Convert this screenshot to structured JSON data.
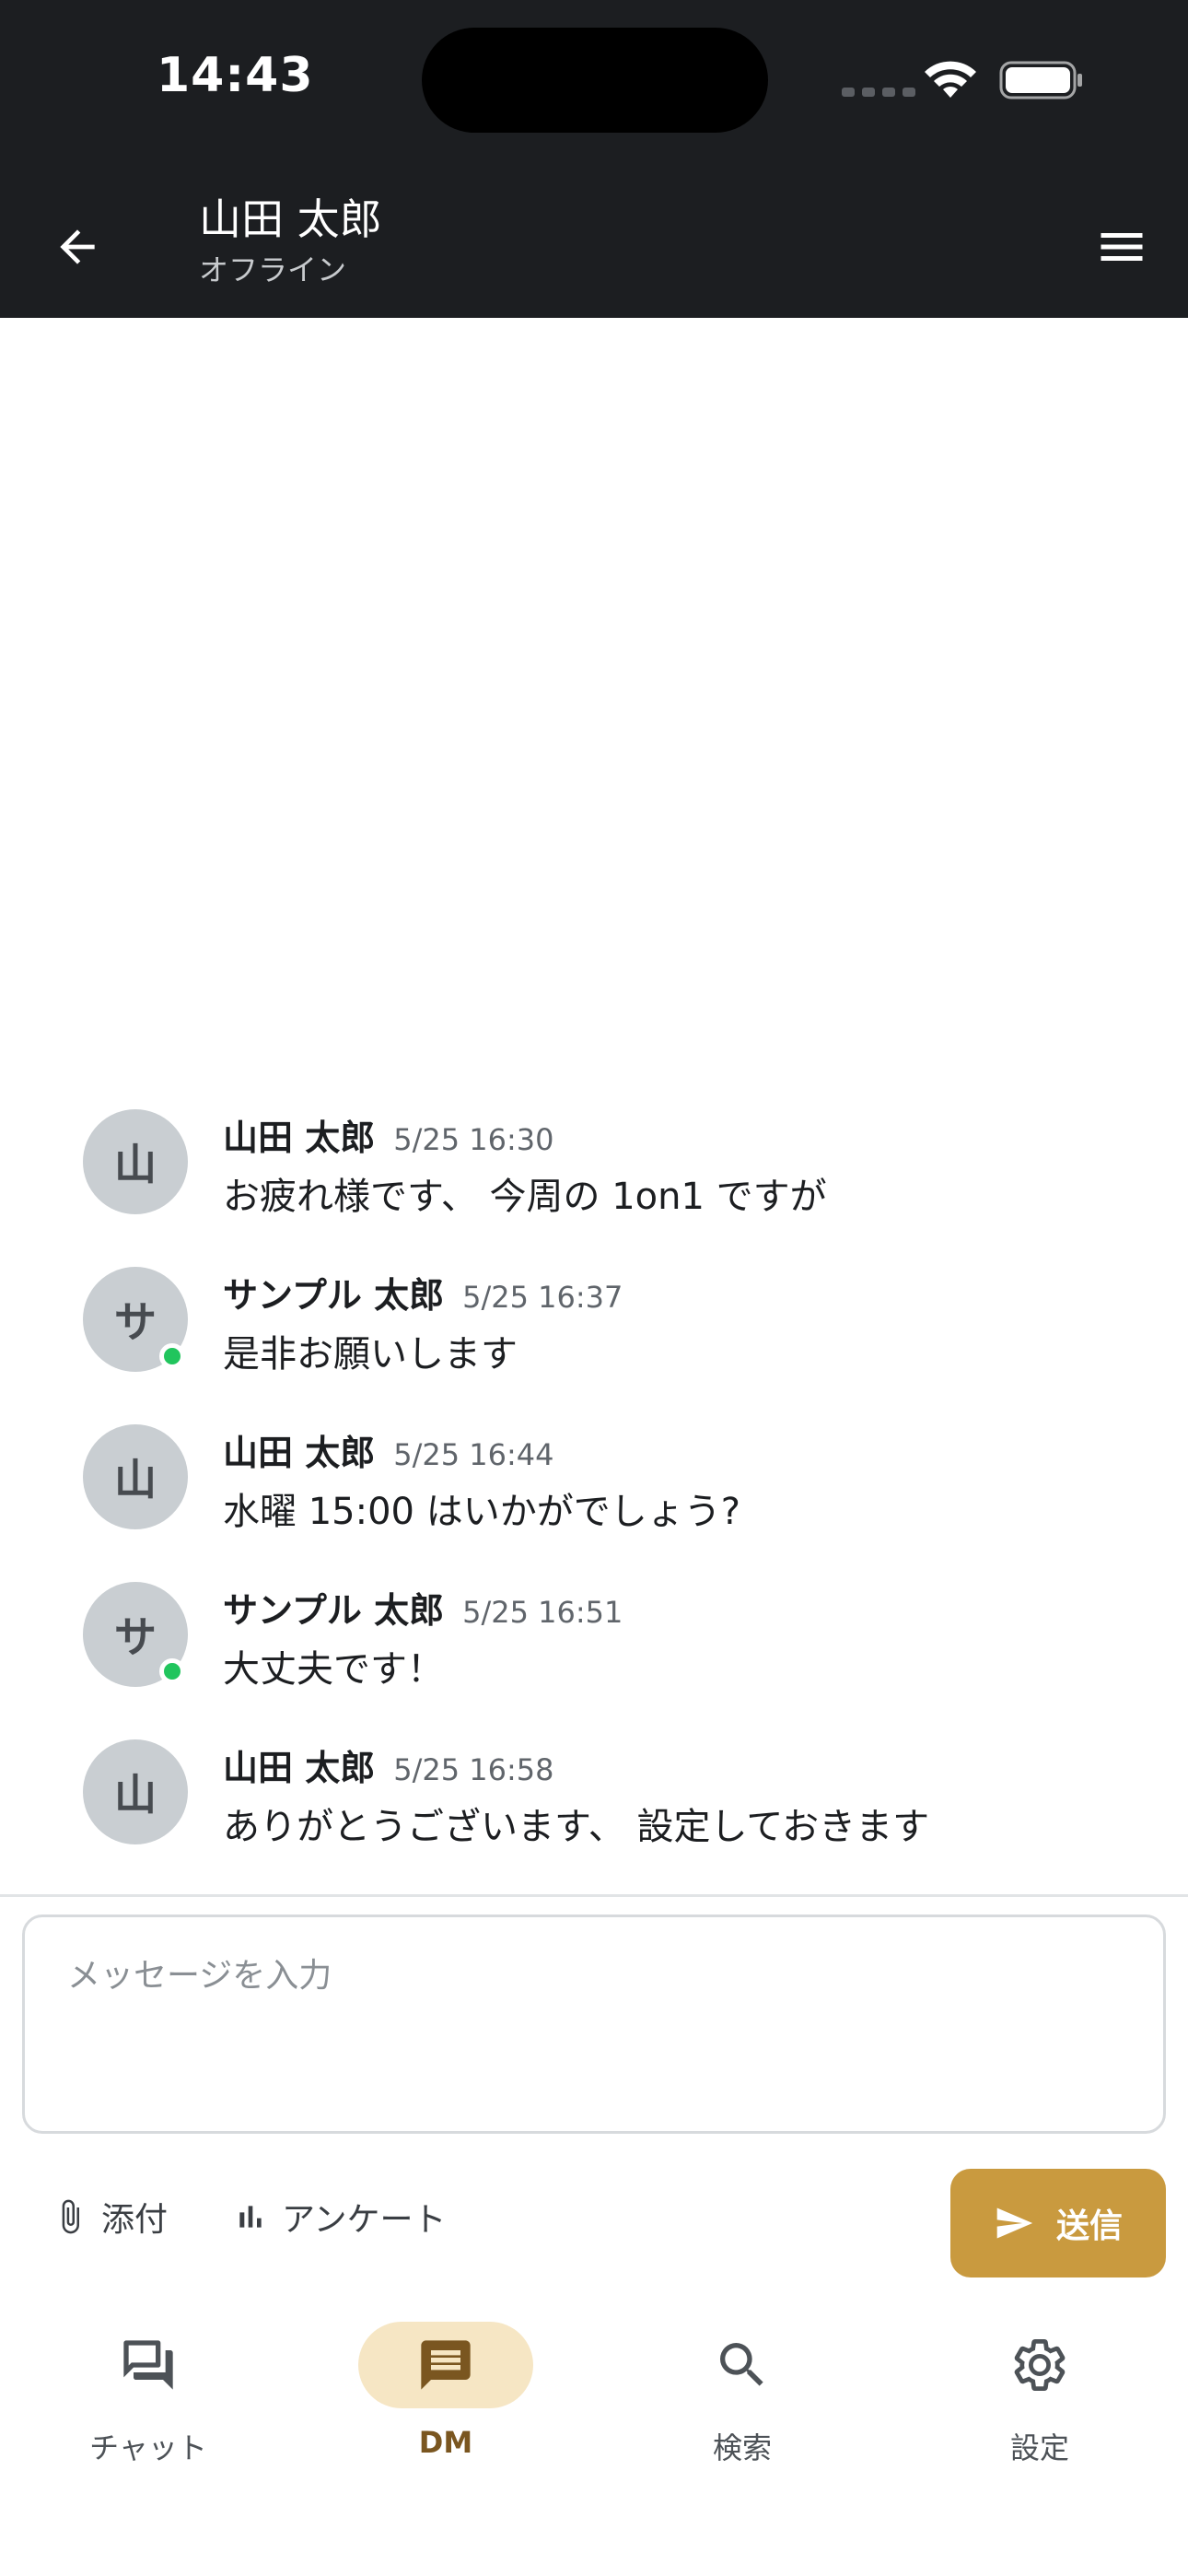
{
  "status_bar": {
    "time": "14:43"
  },
  "header": {
    "title": "山田 太郎",
    "subtitle": "オフライン"
  },
  "messages": [
    {
      "avatar": "山",
      "sender": "山田 太郎",
      "time": "5/25 16:30",
      "text": "お疲れ様です、 今周の 1on1 ですが",
      "online": false
    },
    {
      "avatar": "サ",
      "sender": "サンプル 太郎",
      "time": "5/25 16:37",
      "text": "是非お願いします",
      "online": true
    },
    {
      "avatar": "山",
      "sender": "山田 太郎",
      "time": "5/25 16:44",
      "text": "水曜 15:00 はいかがでしょう?",
      "online": false
    },
    {
      "avatar": "サ",
      "sender": "サンプル 太郎",
      "time": "5/25 16:51",
      "text": "大丈夫です！",
      "online": true
    },
    {
      "avatar": "山",
      "sender": "山田 太郎",
      "time": "5/25 16:58",
      "text": "ありがとうございます、 設定しておきます",
      "online": false
    }
  ],
  "composer": {
    "placeholder": "メッセージを入力",
    "attach_label": "添付",
    "poll_label": "アンケート",
    "send_label": "送信"
  },
  "tabs": [
    {
      "label": "チャット",
      "icon": "chat-bubbles-icon"
    },
    {
      "label": "DM",
      "icon": "dm-message-icon",
      "active": true
    },
    {
      "label": "検索",
      "icon": "search-icon"
    },
    {
      "label": "設定",
      "icon": "gear-icon"
    }
  ],
  "colors": {
    "header_bg": "#1c1e21",
    "accent": "#c99a3f",
    "active_tab_bg": "#f6e6c4",
    "online": "#21c55d"
  }
}
